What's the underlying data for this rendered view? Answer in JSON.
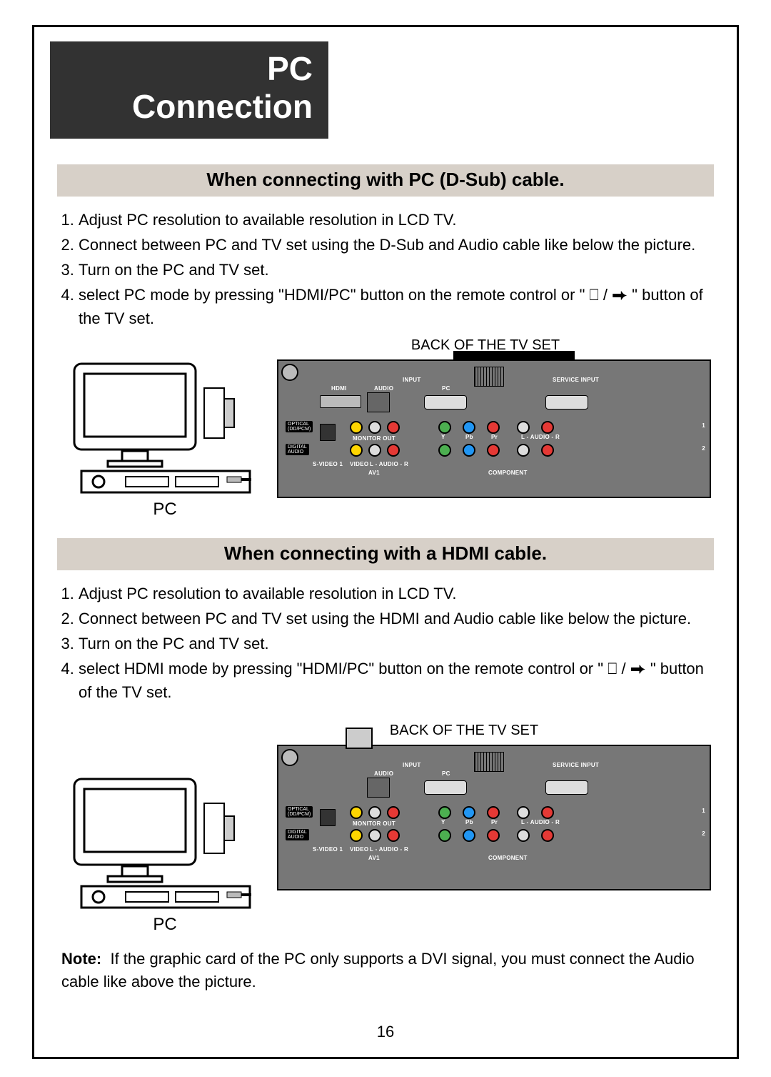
{
  "title_line1": "PC",
  "title_line2": "Connection",
  "section1": {
    "heading": "When connecting with PC (D-Sub) cable.",
    "steps": [
      "Adjust PC resolution to available resolution in LCD TV.",
      "Connect between PC and TV set using the D-Sub and Audio cable like below the picture.",
      "Turn on the PC and TV set.",
      "select PC mode by pressing \"HDMI/PC\" button on the remote control or \"  ⎕ / ⮕  \" button of the TV set."
    ],
    "back_label": "BACK OF THE TV SET",
    "pc_label": "PC"
  },
  "section2": {
    "heading": "When connecting with a HDMI cable.",
    "steps": [
      "Adjust PC resolution to available resolution in LCD TV.",
      "Connect between PC and TV set using the HDMI and Audio cable like below the picture.",
      "Turn on the PC and TV set.",
      "select HDMI mode by pressing \"HDMI/PC\" button on the remote control or \"  ⎕ / ⮕  \" button of the TV set."
    ],
    "back_label": "BACK OF THE TV SET",
    "pc_label": "PC"
  },
  "note_label": "Note:",
  "note_body": "If the graphic card of the PC only supports a DVI signal, you must connect the Audio cable like above the picture.",
  "page_number": "16",
  "panel_labels": {
    "input": "INPUT",
    "service_input": "SERVICE INPUT",
    "hdmi": "HDMI",
    "audio": "AUDIO",
    "pc": "PC",
    "optical": "OPTICAL\n(DD/PCM)",
    "digital_audio": "DIGITAL\nAUDIO",
    "monitor_out": "MONITOR OUT",
    "y": "Y",
    "pb": "Pb",
    "pr": "Pr",
    "laudio_r": "L - AUDIO - R",
    "svideo": "S-VIDEO 1",
    "video": "VIDEO",
    "laudio_r2": "L - AUDIO - R",
    "av1": "AV1",
    "component": "COMPONENT",
    "row1": "1",
    "row2": "2"
  }
}
